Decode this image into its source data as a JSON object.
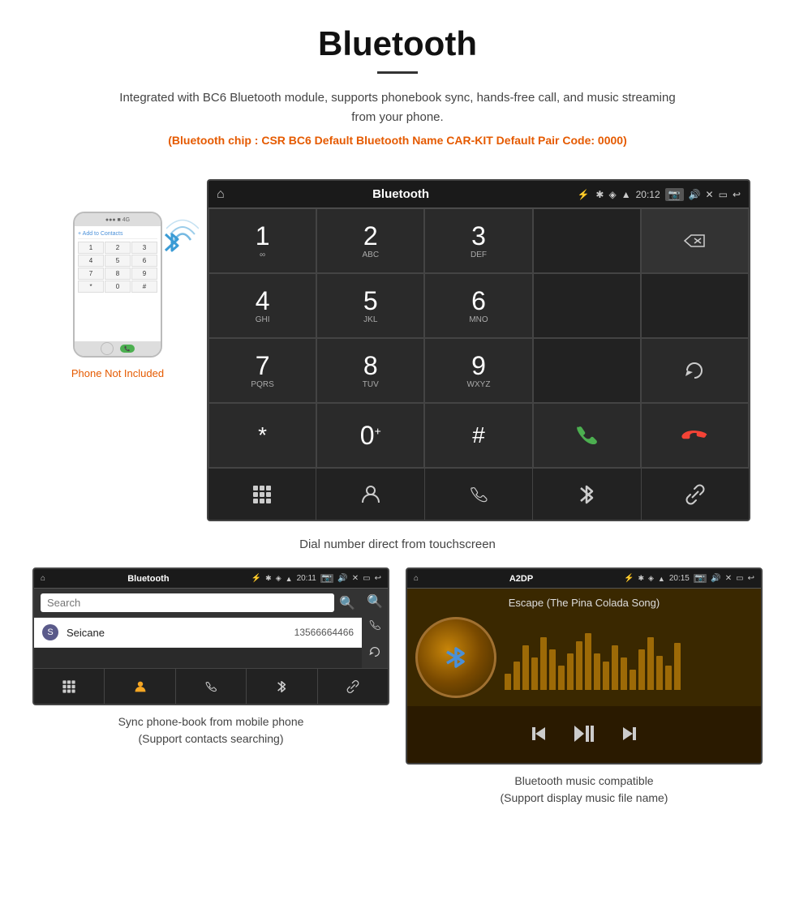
{
  "header": {
    "title": "Bluetooth",
    "description": "Integrated with BC6 Bluetooth module, supports phonebook sync, hands-free call, and music streaming from your phone.",
    "specs": "(Bluetooth chip : CSR BC6    Default Bluetooth Name CAR-KIT    Default Pair Code: 0000)"
  },
  "phone_side": {
    "not_included": "Phone Not Included",
    "add_contacts": "+ Add to Contacts"
  },
  "car_screen": {
    "statusbar": {
      "home": "⌂",
      "title": "Bluetooth",
      "usb": "⚡",
      "bluetooth": "✱",
      "location": "◈",
      "signal": "▲",
      "time": "20:12",
      "camera": "📷",
      "volume": "🔊",
      "close_x": "✕",
      "window": "▭",
      "back": "↩"
    },
    "dialpad": [
      {
        "num": "1",
        "sub": "∞",
        "col": 1
      },
      {
        "num": "2",
        "sub": "ABC",
        "col": 2
      },
      {
        "num": "3",
        "sub": "DEF",
        "col": 3
      },
      {
        "num": "",
        "sub": "",
        "col": 4,
        "type": "display"
      },
      {
        "num": "⌫",
        "sub": "",
        "col": 5,
        "type": "backspace"
      },
      {
        "num": "4",
        "sub": "GHI",
        "col": 1
      },
      {
        "num": "5",
        "sub": "JKL",
        "col": 2
      },
      {
        "num": "6",
        "sub": "MNO",
        "col": 3
      },
      {
        "num": "",
        "sub": "",
        "col": 4,
        "type": "empty"
      },
      {
        "num": "",
        "sub": "",
        "col": 5,
        "type": "empty"
      },
      {
        "num": "7",
        "sub": "PQRS",
        "col": 1
      },
      {
        "num": "8",
        "sub": "TUV",
        "col": 2
      },
      {
        "num": "9",
        "sub": "WXYZ",
        "col": 3
      },
      {
        "num": "",
        "sub": "",
        "col": 4,
        "type": "empty"
      },
      {
        "num": "↺",
        "sub": "",
        "col": 5,
        "type": "reload"
      },
      {
        "num": "*",
        "sub": "",
        "col": 1
      },
      {
        "num": "0",
        "sub": "+",
        "col": 2
      },
      {
        "num": "#",
        "sub": "",
        "col": 3
      },
      {
        "num": "📞",
        "sub": "",
        "col": 4,
        "type": "call-green"
      },
      {
        "num": "📞",
        "sub": "",
        "col": 5,
        "type": "call-red"
      }
    ],
    "bottom_nav": [
      "⊞",
      "👤",
      "📞",
      "✱",
      "🔗"
    ]
  },
  "main_caption": "Dial number direct from touchscreen",
  "phonebook_screen": {
    "statusbar_title": "Bluetooth",
    "statusbar_time": "20:11",
    "search_placeholder": "Search",
    "contact_letter": "S",
    "contact_name": "Seicane",
    "contact_number": "13566664466",
    "bottom_nav": [
      "⊞",
      "👤",
      "📞",
      "✱",
      "🔗"
    ]
  },
  "music_screen": {
    "statusbar_title": "A2DP",
    "statusbar_time": "20:15",
    "song_title": "Escape (The Pina Colada Song)",
    "viz_heights": [
      20,
      35,
      55,
      40,
      65,
      50,
      30,
      45,
      60,
      70,
      45,
      35,
      55,
      40,
      25,
      50,
      65,
      42,
      30,
      58
    ]
  },
  "bottom_captions": {
    "phonebook": "Sync phone-book from mobile phone\n(Support contacts searching)",
    "music": "Bluetooth music compatible\n(Support display music file name)"
  }
}
